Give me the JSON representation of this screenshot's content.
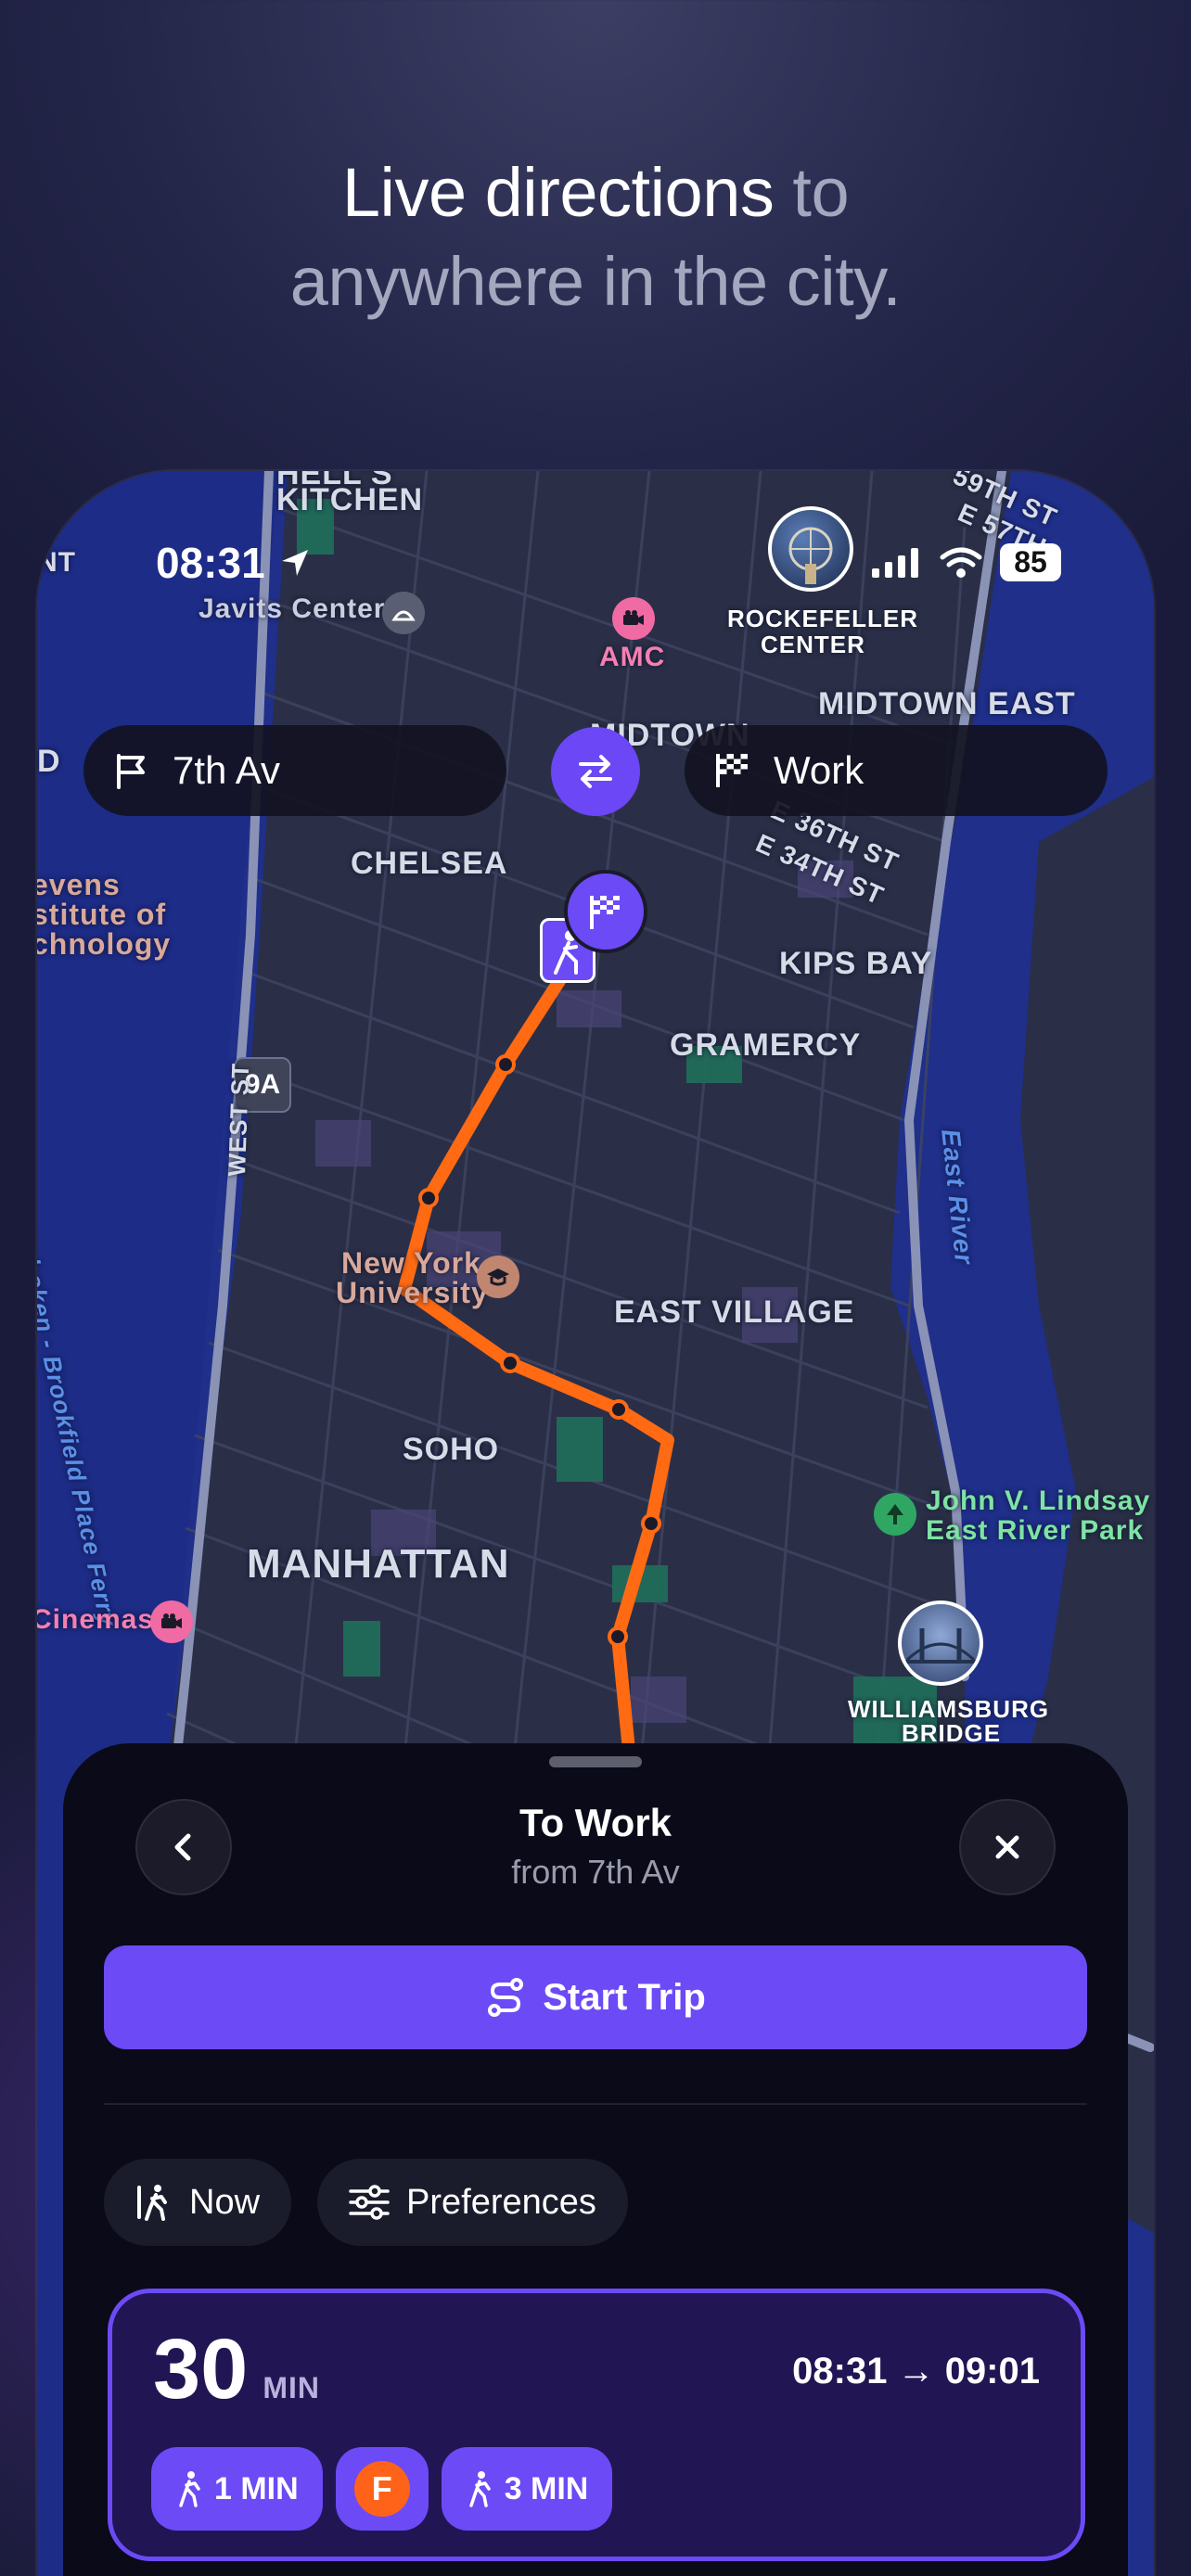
{
  "headline": {
    "part1": "Live directions",
    "part2": " to",
    "part3": "anywhere in the city."
  },
  "status_bar": {
    "time": "08:31",
    "battery": "85",
    "icons": [
      "location-arrow-icon",
      "signal-icon",
      "wifi-icon",
      "battery-icon"
    ]
  },
  "search": {
    "from_label": "7th Av",
    "to_label": "Work",
    "from_icon": "flag-icon",
    "to_icon": "checkered-flag-icon",
    "swap_icon": "swap-arrows-icon"
  },
  "map": {
    "labels": {
      "hells_kitchen": "KITCHEN",
      "hells_top": "HELL'S",
      "javits": "Javits Center",
      "amc": "AMC",
      "rockefeller": "ROCKEFELLER",
      "rockefeller2": "CENTER",
      "midtown_east": "MIDTOWN EAST",
      "midtown": "MIDTOWN",
      "nt": "NT",
      "d": "D",
      "st59": "59TH ST",
      "st57": "E 57TH",
      "chelsea": "CHELSEA",
      "st36": "E 36TH ST",
      "st34": "E 34TH ST",
      "stevens1": "evens",
      "stevens2": "stitute of",
      "stevens3": "chnology",
      "kips_bay": "KIPS BAY",
      "gramercy": "GRAMERCY",
      "route_9a": "9A",
      "west_st": "WEST ST",
      "east_river": "East River",
      "nyu1": "New York",
      "nyu2": "University",
      "east_village": "EAST VILLAGE",
      "hoboken_ferry": "Hoboken - Brookfield Place Ferry",
      "soho": "SOHO",
      "lindsay1": "John V. Lindsay",
      "lindsay2": "East River Park",
      "manhattan": "MANHATTAN",
      "cinemas": "Cinemas",
      "williamsburg1": "WILLIAMSBURG",
      "williamsburg2": "BRIDGE"
    },
    "colors": {
      "water": "#1f2f8a",
      "land": "#2b3048",
      "route": "#ff6a13",
      "accent": "#6c4af6"
    }
  },
  "sheet": {
    "title": "To Work",
    "subtitle": "from 7th Av",
    "back_icon": "chevron-left-icon",
    "close_icon": "close-icon",
    "start_label": "Start Trip",
    "start_icon": "route-icon",
    "chips": [
      {
        "label": "Now",
        "icon": "walking-time-icon"
      },
      {
        "label": "Preferences",
        "icon": "sliders-icon"
      }
    ],
    "route": {
      "duration": "30",
      "duration_unit": "MIN",
      "time_range": "08:31 → 09:01",
      "legs": [
        {
          "type": "walk",
          "label": "1 MIN",
          "icon": "walking-icon"
        },
        {
          "type": "train",
          "label": "F",
          "color": "#ff6319"
        },
        {
          "type": "walk",
          "label": "3 MIN",
          "icon": "walking-icon"
        }
      ]
    }
  }
}
